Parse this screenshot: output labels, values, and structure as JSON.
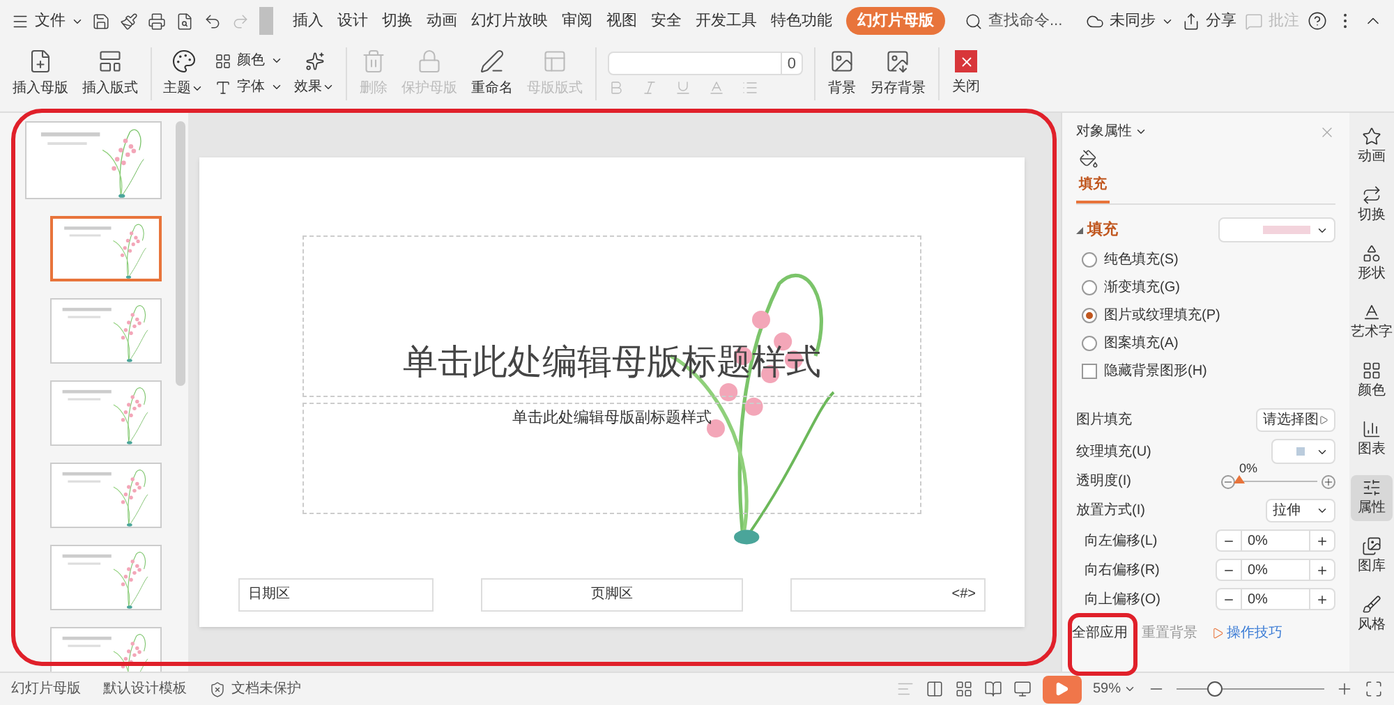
{
  "menu_bar": {
    "file_menu": "文件",
    "tabs": [
      {
        "label": "插入",
        "selected": false
      },
      {
        "label": "设计",
        "selected": false
      },
      {
        "label": "切换",
        "selected": false
      },
      {
        "label": "动画",
        "selected": false
      },
      {
        "label": "幻灯片放映",
        "selected": false
      },
      {
        "label": "审阅",
        "selected": false
      },
      {
        "label": "视图",
        "selected": false
      },
      {
        "label": "安全",
        "selected": false
      },
      {
        "label": "开发工具",
        "selected": false
      },
      {
        "label": "特色功能",
        "selected": false
      },
      {
        "label": "幻灯片母版",
        "selected": true
      }
    ],
    "search_placeholder": "查找命令...",
    "sync": "未同步",
    "share": "分享",
    "comment": "批注"
  },
  "ribbon": {
    "items": [
      {
        "kind": "big",
        "label": "插入母版",
        "disabled": false
      },
      {
        "kind": "big",
        "label": "插入版式",
        "disabled": false
      },
      {
        "kind": "sep"
      },
      {
        "kind": "theme",
        "label": "主题",
        "colors": "颜色",
        "font": "字体",
        "effect": "效果"
      },
      {
        "kind": "sep"
      },
      {
        "kind": "big",
        "label": "删除",
        "disabled": true
      },
      {
        "kind": "big",
        "label": "保护母版",
        "disabled": true
      },
      {
        "kind": "big",
        "label": "重命名",
        "disabled": false
      },
      {
        "kind": "big",
        "label": "母版版式",
        "disabled": true
      },
      {
        "kind": "sep"
      },
      {
        "kind": "font",
        "size": "0"
      },
      {
        "kind": "sep"
      },
      {
        "kind": "big",
        "label": "背景",
        "disabled": false
      },
      {
        "kind": "big",
        "label": "另存背景",
        "disabled": false
      },
      {
        "kind": "sep"
      },
      {
        "kind": "close",
        "label": "关闭",
        "disabled": false
      }
    ]
  },
  "thumbnails": [
    {
      "kind": "master",
      "selected": false
    },
    {
      "kind": "layout",
      "selected": true
    },
    {
      "kind": "layout",
      "selected": false
    },
    {
      "kind": "layout",
      "selected": false
    },
    {
      "kind": "layout",
      "selected": false
    },
    {
      "kind": "layout",
      "selected": false
    },
    {
      "kind": "layout",
      "selected": false
    }
  ],
  "slide": {
    "title": "单击此处编辑母版标题样式",
    "subtitle": "单击此处编辑母版副标题样式",
    "date_area": "日期区",
    "footer_area": "页脚区",
    "page_number": "<#>"
  },
  "property_pane": {
    "title": "对象属性",
    "tabs": [
      {
        "label": "填充",
        "selected": true
      }
    ],
    "section": "填充",
    "fill_options": [
      {
        "label": "纯色填充(S)",
        "selected": false
      },
      {
        "label": "渐变填充(G)",
        "selected": false
      },
      {
        "label": "图片或纹理填充(P)",
        "selected": true
      },
      {
        "label": "图案填充(A)",
        "selected": false
      }
    ],
    "hide_background": {
      "label": "隐藏背景图形(H)",
      "checked": false
    },
    "picture_fill": {
      "label": "图片填充",
      "button": "请选择图"
    },
    "texture_fill": {
      "label": "纹理填充(U)"
    },
    "transparency": {
      "label": "透明度(I)",
      "reading": "0%",
      "level": 0
    },
    "placement": {
      "label": "放置方式(I)",
      "value": "拉伸"
    },
    "offsets": [
      {
        "label": "向左偏移(L)",
        "value": "0%"
      },
      {
        "label": "向右偏移(R)",
        "value": "0%"
      },
      {
        "label": "向上偏移(O)",
        "value": "0%"
      }
    ],
    "apply_all": "全部应用",
    "reset": "重置背景",
    "tips": "操作技巧"
  },
  "side_tools": [
    {
      "label": "动画",
      "selected": false
    },
    {
      "label": "切换",
      "selected": false
    },
    {
      "label": "形状",
      "selected": false
    },
    {
      "label": "艺术字",
      "selected": false
    },
    {
      "label": "颜色",
      "selected": false
    },
    {
      "label": "图表",
      "selected": false
    },
    {
      "label": "属性",
      "selected": true
    },
    {
      "label": "图库",
      "selected": false
    },
    {
      "label": "风格",
      "selected": false
    }
  ],
  "status_bar": {
    "view": "幻灯片母版",
    "template": "默认设计模板",
    "protection": "文档未保护",
    "zoom": "59%",
    "zoom_slider": {
      "level": 0.25
    }
  }
}
